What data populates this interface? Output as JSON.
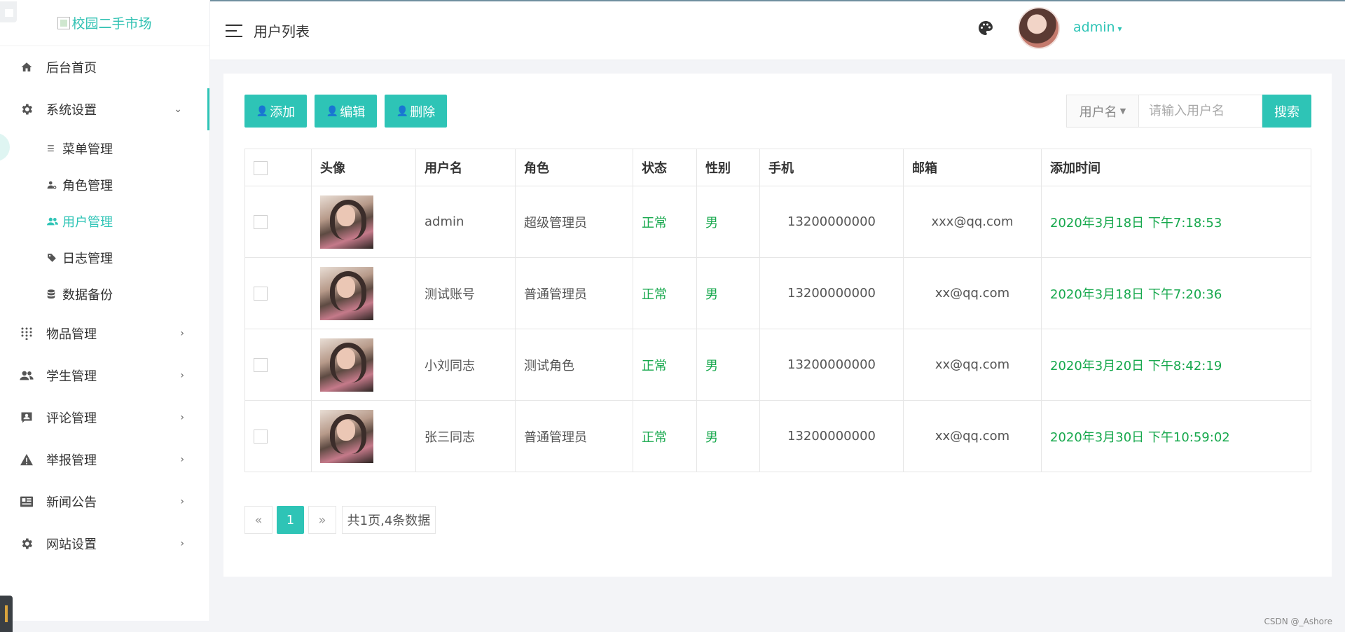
{
  "logo": {
    "alt_text": "校园二手市场"
  },
  "header": {
    "title": "用户列表",
    "username": "admin"
  },
  "sidebar": {
    "items": [
      {
        "label": "后台首页",
        "icon": "home-icon"
      },
      {
        "label": "系统设置",
        "icon": "gear-icon",
        "expanded": true,
        "children": [
          {
            "label": "菜单管理",
            "icon": "list-icon"
          },
          {
            "label": "角色管理",
            "icon": "user-gear-icon"
          },
          {
            "label": "用户管理",
            "icon": "users-icon",
            "active": true
          },
          {
            "label": "日志管理",
            "icon": "tags-icon"
          },
          {
            "label": "数据备份",
            "icon": "database-icon"
          }
        ]
      },
      {
        "label": "物品管理",
        "icon": "grid-icon"
      },
      {
        "label": "学生管理",
        "icon": "people-icon"
      },
      {
        "label": "评论管理",
        "icon": "comment-user-icon"
      },
      {
        "label": "举报管理",
        "icon": "warning-icon"
      },
      {
        "label": "新闻公告",
        "icon": "newspaper-icon"
      },
      {
        "label": "网站设置",
        "icon": "gear-icon"
      }
    ]
  },
  "toolbar": {
    "add_label": "添加",
    "edit_label": "编辑",
    "delete_label": "删除"
  },
  "search": {
    "field_label": "用户名",
    "placeholder": "请输入用户名",
    "button_label": "搜索"
  },
  "table": {
    "columns": [
      "头像",
      "用户名",
      "角色",
      "状态",
      "性别",
      "手机",
      "邮箱",
      "添加时间"
    ],
    "rows": [
      {
        "username": "admin",
        "role": "超级管理员",
        "status": "正常",
        "gender": "男",
        "phone": "13200000000",
        "email": "xxx@qq.com",
        "created": "2020年3月18日 下午7:18:53"
      },
      {
        "username": "测试账号",
        "role": "普通管理员",
        "status": "正常",
        "gender": "男",
        "phone": "13200000000",
        "email": "xx@qq.com",
        "created": "2020年3月18日 下午7:20:36"
      },
      {
        "username": "小刘同志",
        "role": "测试角色",
        "status": "正常",
        "gender": "男",
        "phone": "13200000000",
        "email": "xx@qq.com",
        "created": "2020年3月20日 下午8:42:19"
      },
      {
        "username": "张三同志",
        "role": "普通管理员",
        "status": "正常",
        "gender": "男",
        "phone": "13200000000",
        "email": "xx@qq.com",
        "created": "2020年3月30日 下午10:59:02"
      }
    ]
  },
  "pagination": {
    "prev": "«",
    "current": "1",
    "next": "»",
    "info": "共1页,4条数据"
  },
  "watermark": "CSDN @_Ashore",
  "colors": {
    "accent": "#2ec4b6",
    "status_green": "#17a84d"
  }
}
